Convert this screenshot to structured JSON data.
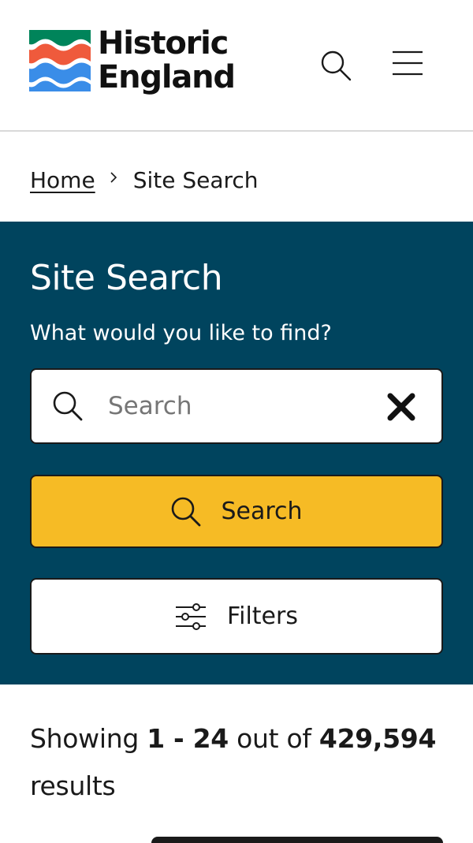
{
  "brand": {
    "line1": "Historic",
    "line2": "England",
    "colors": {
      "green": "#00845a",
      "red": "#ef5a3c",
      "blue": "#3a8de8"
    }
  },
  "header": {
    "search_icon": "search-icon",
    "menu_icon": "hamburger-menu-icon"
  },
  "breadcrumb": {
    "home": "Home",
    "separator": "›",
    "current": "Site Search"
  },
  "search_panel": {
    "title": "Site Search",
    "subtitle": "What would you like to find?",
    "input_value": "",
    "input_placeholder": "Search",
    "search_button_label": "Search",
    "filters_button_label": "Filters",
    "background_color": "#00445e",
    "search_button_color": "#f6bb25"
  },
  "results": {
    "prefix": "Showing",
    "range": "1 - 24",
    "middle": "out of",
    "total": "429,594",
    "suffix": "results"
  }
}
